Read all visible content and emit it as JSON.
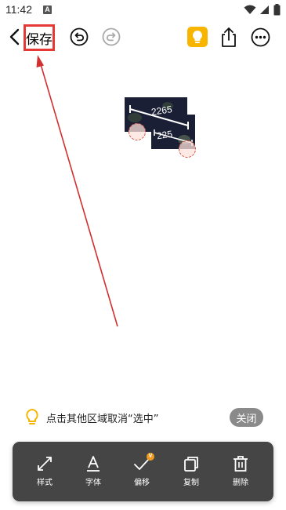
{
  "status_bar": {
    "time": "11:42",
    "notification_letter": "A"
  },
  "toolbar": {
    "save_label": "保存"
  },
  "canvas": {
    "measurements": [
      {
        "value": "2265"
      },
      {
        "value": "225"
      }
    ]
  },
  "hint": {
    "text": "点击其他区域取消“选中”",
    "close_label": "关闭"
  },
  "bottom_toolbar": {
    "items": [
      {
        "label": "样式",
        "icon": "resize-diagonal-icon"
      },
      {
        "label": "字体",
        "icon": "font-a-icon"
      },
      {
        "label": "偏移",
        "icon": "offset-check-icon",
        "badge": "V"
      },
      {
        "label": "复制",
        "icon": "copy-icon"
      },
      {
        "label": "删除",
        "icon": "trash-icon"
      }
    ]
  },
  "colors": {
    "highlight_box": "#e53935",
    "annotation_arrow": "#d32f2f",
    "bulb_button": "#f7b500",
    "bottom_toolbar_bg": "#454545",
    "close_button_bg": "#8a8a8a",
    "badge": "#f29c1f"
  }
}
